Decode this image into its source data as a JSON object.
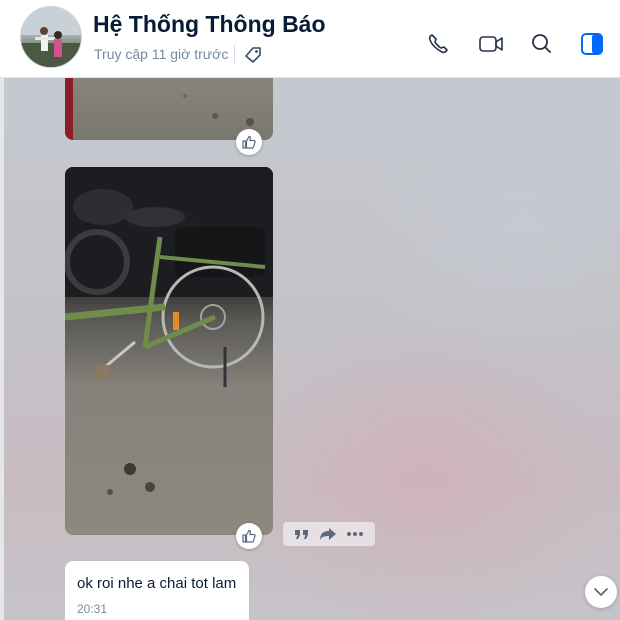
{
  "header": {
    "title": "Hệ Thống Thông Báo",
    "status": "Truy cập 11 giờ trước",
    "icons": [
      "tag-icon",
      "phone-icon",
      "video-icon",
      "search-icon",
      "sidebar-toggle-icon"
    ],
    "accent_color": "#0068ff"
  },
  "messages": {
    "text_message": {
      "text": "ok roi nhe a chai tot lam",
      "time": "20:31"
    }
  },
  "actions": {
    "icons": [
      "quote-icon",
      "share-icon",
      "more-icon"
    ]
  }
}
